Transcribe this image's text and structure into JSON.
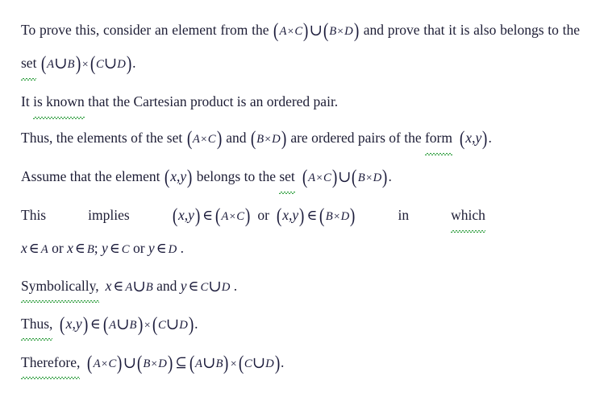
{
  "document": {
    "type": "math-proof-text",
    "language": "en",
    "text_color": "#1d1d35",
    "background_color": "#ffffff",
    "spellcheck_underline_color": "#2f9e3f",
    "paragraphs": [
      {
        "id": "p1",
        "lines": [
          "To prove this, consider an element from the (A×C)∪(B×D) and prove that",
          "it is also belongs to the set (A∪B)×(C∪D)."
        ],
        "plain": "To prove this, consider an element from the (A×C)∪(B×D) and prove that it is also belongs to the set (A∪B)×(C∪D).",
        "lead_text": "To prove this, consider an element from the ",
        "mid_text": " and prove that it is also belongs to the ",
        "misspelled_words": [
          "set"
        ],
        "tail_text": " ",
        "end_punct": "."
      },
      {
        "id": "p2",
        "plain": "It is known that the Cartesian product is an ordered pair.",
        "before": "It ",
        "misspelled_words": [
          "is known"
        ],
        "after": " that the Cartesian product is an ordered pair."
      },
      {
        "id": "p3",
        "plain": "Thus, the elements of the set (A×C) and (B×D) are ordered pairs of the form (x, y).",
        "lead_text": "Thus, the elements of the set ",
        "join_text": " and ",
        "tail_text": " are ordered pairs of the ",
        "misspelled_words": [
          "form"
        ],
        "end_punct": "."
      },
      {
        "id": "p4",
        "plain": "Assume that the element (x, y) belongs to the set (A×C)∪(B×D).",
        "lead_text": "Assume that the element ",
        "mid_text": " belongs to the ",
        "misspelled_words": [
          "set"
        ],
        "end_punct": "."
      },
      {
        "id": "p5",
        "plain": "This implies (x,y)∈(A×C) or (x,y)∈(B×D) in which x ∈ A or x ∈ B; y ∈ C or y ∈ D.",
        "word_this": "This",
        "word_implies": "implies",
        "word_or": "or",
        "word_in": "in",
        "misspelled_words": [
          "which"
        ],
        "second_line_text": "x ∈ A or x ∈ B; y ∈ C or y ∈ D.",
        "end_punct": "."
      },
      {
        "id": "p6",
        "plain": "Symbolically, x ∈ A∪B and y ∈ C∪D.",
        "lead_text": "Symbolically,",
        "has_squiggle_after_comma": true,
        "join_text": " and ",
        "end_punct": "."
      },
      {
        "id": "p7",
        "plain": "Thus, (x,y)∈(A∪B)×(C∪D).",
        "lead_text": "Thus,",
        "has_squiggle_after_comma": true,
        "end_punct": "."
      },
      {
        "id": "p8",
        "plain": "Therefore, (A×C)∪(B×D)⊆(A∪B)×(C∪D).",
        "lead_text": "Therefore,",
        "has_squiggle_after_comma": true,
        "end_punct": "."
      }
    ],
    "symbols": {
      "union": "∪",
      "times": "×",
      "element_of": "∈",
      "subset_eq": "⊆",
      "lparen": "(",
      "rparen": ")",
      "comma": ",",
      "semicolon": ";",
      "period": "."
    },
    "sets": {
      "A": "A",
      "B": "B",
      "C": "C",
      "D": "D",
      "x": "x",
      "y": "y"
    }
  }
}
